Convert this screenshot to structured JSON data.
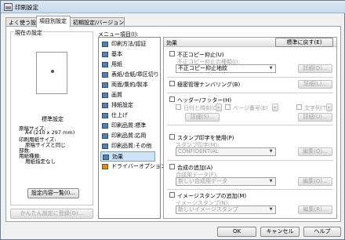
{
  "window": {
    "title": "印刷設定"
  },
  "tabs": [
    "よく使う設定",
    "項目別設定",
    "初期設定/バージョン"
  ],
  "left": {
    "current_settings_label": "現在の設定",
    "profile_name": "標準設定",
    "details": [
      "原稿サイズ:",
      "A4 (210 x 297 mm)",
      "印刷用紙サイズ:",
      "原稿サイズと同じ",
      "部数:",
      "用紙種類:",
      "用紙指定なし"
    ],
    "settings_list_button": "設定内容一覧(I)...",
    "register_button": "かんたん設定に登録(G)..."
  },
  "menu": {
    "label": "メニュー項目(I):",
    "items": [
      "印刷方法/認証",
      "基本",
      "用紙",
      "表紙/合紙/章区切り",
      "両面/集約/製本",
      "画質",
      "排紙設定",
      "仕上げ",
      "印刷品質:標準",
      "印刷品質:応用",
      "印刷品質:その他",
      "効果",
      "ドライバーオプション"
    ],
    "selected": "効果"
  },
  "effects": {
    "header": "効果",
    "reset_button": "標準に戻す(E)",
    "unauthorized_copy": {
      "label": "不正コピー抑止(U)",
      "type_label": "不正コピー抑止の種類(J):",
      "type_value": "不正コピー抑止地紋",
      "details": "詳細(D)..."
    },
    "confidential_numbering": {
      "label": "極密管理ナンバリング(B)",
      "details": "詳細(L)..."
    },
    "header_footer": {
      "label": "ヘッダー/フッター(H)",
      "datetime": "日付と時刻(D)",
      "page_number": "ページ番号(E)",
      "text": "文字列(T)",
      "details1": "詳細(S)...",
      "details2": "詳細(U)..."
    },
    "stamp": {
      "label": "スタンプ印字を使用(P)",
      "select_label": "スタンプ印字(M):",
      "value": "CONFIDENTIAL",
      "edit": "編集(Q)..."
    },
    "overlay": {
      "label": "合成の追加(A)",
      "data_label": "合成用データ(F):",
      "value": "新しい合成用データ",
      "edit": "編集(O)..."
    },
    "image_stamp": {
      "label": "イメージスタンプの追加(M)",
      "select_label": "イメージスタンプ(N):",
      "value": "新しいイメージスタンプ",
      "edit": "編集(R)..."
    }
  },
  "footer": {
    "ok": "OK",
    "cancel": "キャンセル",
    "help": "ヘルプ"
  }
}
